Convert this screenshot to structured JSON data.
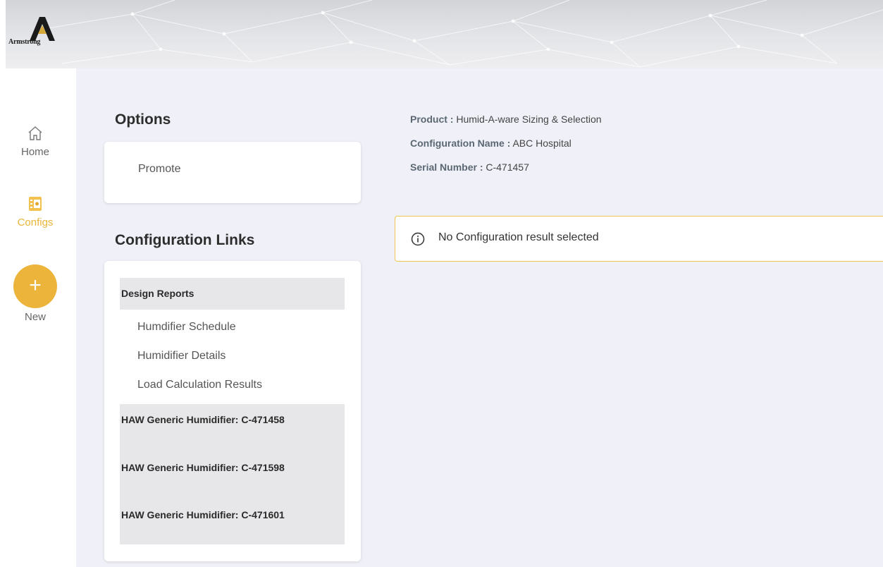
{
  "brand": {
    "logo_text": "Armstrong"
  },
  "sidebar": {
    "items": [
      {
        "label": "Home",
        "icon": "home-icon"
      },
      {
        "label": "Configs",
        "icon": "config-icon",
        "active": true
      },
      {
        "label": "New",
        "icon": "plus-icon"
      }
    ]
  },
  "options": {
    "title": "Options",
    "items": [
      "Promote"
    ]
  },
  "config_links": {
    "title": "Configuration Links",
    "design_reports": {
      "label": "Design Reports",
      "links": [
        "Humdifier Schedule",
        "Humidifier Details",
        "Load Calculation Results"
      ]
    },
    "generic": [
      "HAW Generic Humidifier: C-471458",
      "HAW Generic Humidifier: C-471598",
      "HAW Generic Humidifier: C-471601"
    ]
  },
  "info": {
    "product_label": "Product :",
    "product_value": "Humid-A-ware Sizing & Selection",
    "config_name_label": "Configuration Name :",
    "config_name_value": "ABC Hospital",
    "serial_label": "Serial Number :",
    "serial_value": "C-471457"
  },
  "alert": {
    "icon": "info-icon",
    "text": "No Configuration result selected"
  },
  "colors": {
    "accent": "#ecb43a",
    "background": "#f0f1f8",
    "alert_border": "#f0c64e"
  }
}
